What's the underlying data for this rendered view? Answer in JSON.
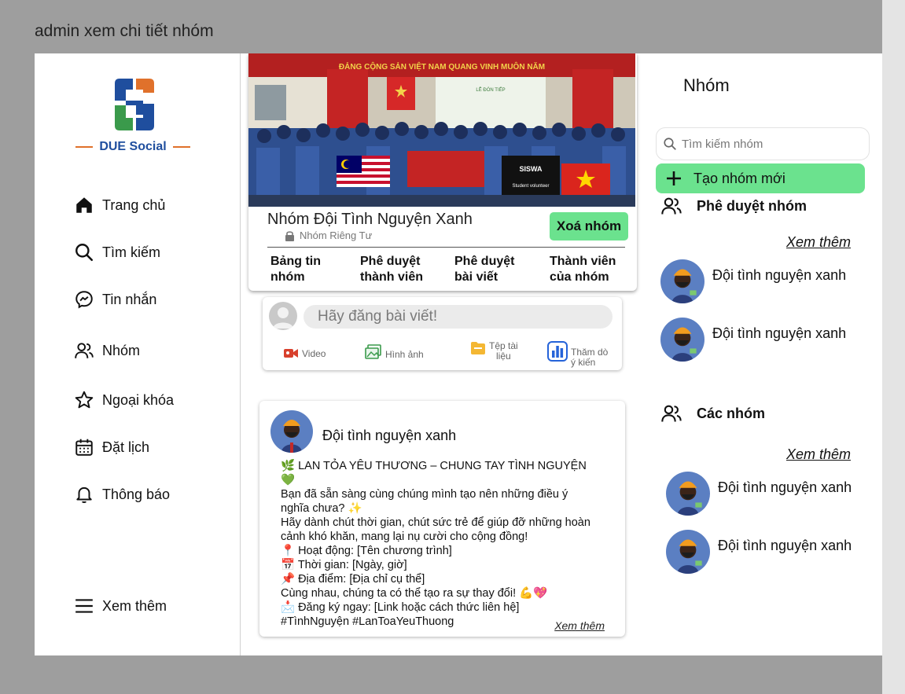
{
  "frame_title": "admin xem chi tiết nhóm",
  "app": {
    "name": "DUE Social"
  },
  "sidebar": {
    "items": [
      {
        "label": "Trang chủ",
        "icon": "home-icon"
      },
      {
        "label": "Tìm kiếm",
        "icon": "search-icon"
      },
      {
        "label": "Tin nhắn",
        "icon": "messenger-icon"
      },
      {
        "label": "Nhóm",
        "icon": "people-icon"
      },
      {
        "label": "Ngoại khóa",
        "icon": "star-icon"
      },
      {
        "label": "Đặt lịch",
        "icon": "calendar-icon"
      },
      {
        "label": "Thông báo",
        "icon": "bell-icon"
      }
    ],
    "more_label": "Xem thêm"
  },
  "group": {
    "name": "Nhóm Đội Tình Nguyện Xanh",
    "privacy": "Nhóm Riêng Tư",
    "delete_label": "Xoá nhóm",
    "tabs": [
      {
        "label": "Bảng tin\nnhóm"
      },
      {
        "label": "Phê duyệt\nthành viên"
      },
      {
        "label": "Phê duyệt\nbài viết"
      },
      {
        "label": "Thành viên\ncủa nhóm"
      }
    ],
    "cover_texts": {
      "banner": "ĐẢNG CỘNG SẢN VIỆT NAM QUANG VINH MUÔN NĂM",
      "screen": "LỄ ĐÓN TIẾP",
      "flag1": "SISWA",
      "flag2": "Student volunteer"
    }
  },
  "composer": {
    "placeholder": "Hãy đăng bài viết!",
    "options": [
      {
        "label": "Video",
        "icon": "video-icon"
      },
      {
        "label": "Hình ảnh",
        "icon": "image-icon"
      },
      {
        "label": "Tệp tài\nliệu",
        "icon": "folder-icon"
      },
      {
        "label": "Thăm dò\ný kiến",
        "icon": "poll-icon"
      }
    ]
  },
  "post": {
    "author": "Đội tình nguyện xanh",
    "body": "🌿 LAN TỎA YÊU THƯƠNG – CHUNG TAY TÌNH NGUYỆN 💚\nBạn đã sẵn sàng cùng chúng mình tạo nên những điều ý nghĩa chưa? ✨\n Hãy dành chút thời gian, chút sức trẻ để giúp đỡ những hoàn cảnh khó khăn, mang lại nụ cười cho cộng đồng!\n📍 Hoạt động: [Tên chương trình]\n📅 Thời gian: [Ngày, giờ]\n📌 Địa điểm: [Địa chỉ cụ thể]\nCùng nhau, chúng ta có thể tạo ra sự thay đổi! 💪💖\n📩 Đăng ký ngay: [Link hoặc cách thức liên hệ]\n#TìnhNguyện #LanToaYeuThuong",
    "more_label": "Xem thêm"
  },
  "right": {
    "title": "Nhóm",
    "search_placeholder": "Tìm kiếm nhóm",
    "create_label": "Tạo nhóm mới",
    "approve": {
      "title": "Phê duyệt nhóm",
      "more_label": "Xem thêm",
      "items": [
        {
          "name": "Đội tình nguyện xanh"
        },
        {
          "name": "Đội tình nguyện xanh"
        }
      ]
    },
    "groups": {
      "title": "Các nhóm",
      "more_label": "Xem thêm",
      "items": [
        {
          "name": "Đội tình nguyện xanh"
        },
        {
          "name": "Đội tình nguyện xanh"
        }
      ]
    }
  },
  "colors": {
    "accent_green": "#6be28e",
    "brand_blue": "#1f4e9e",
    "brand_orange": "#e0712b",
    "brand_green": "#3a9a4b"
  }
}
